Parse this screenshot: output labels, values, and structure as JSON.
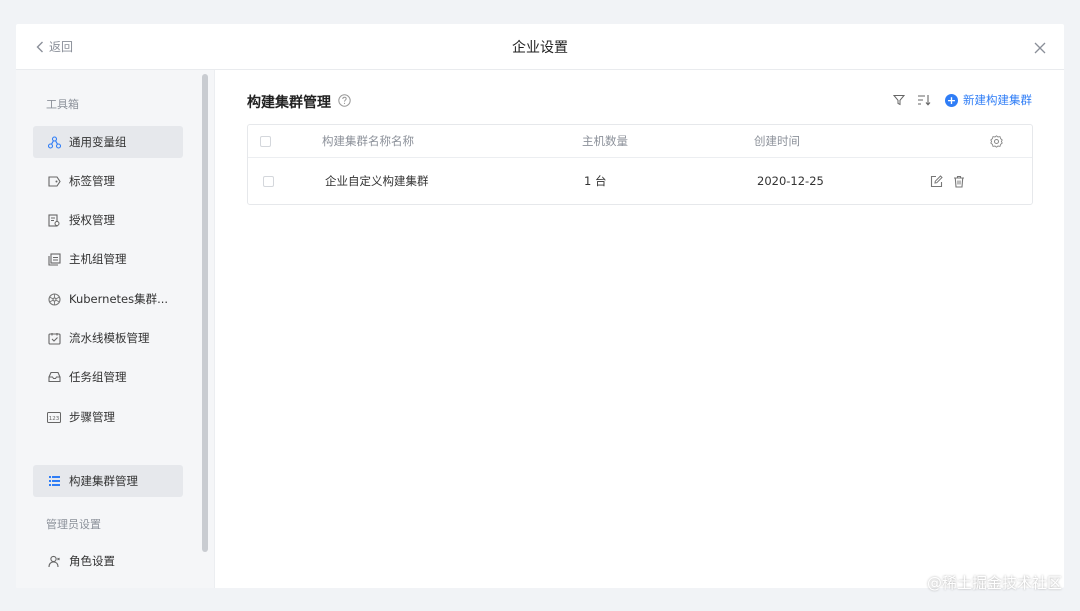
{
  "header": {
    "back_label": "返回",
    "title": "企业设置"
  },
  "sidebar": {
    "section_tools": "工具箱",
    "items": [
      {
        "label": "通用变量组",
        "icon": "variable-group-icon",
        "active": true
      },
      {
        "label": "标签管理",
        "icon": "tag-icon",
        "active": false
      },
      {
        "label": "授权管理",
        "icon": "authorization-icon",
        "active": false
      },
      {
        "label": "主机组管理",
        "icon": "host-group-icon",
        "active": false
      },
      {
        "label": "Kubernetes集群...",
        "icon": "kubernetes-icon",
        "active": false
      },
      {
        "label": "流水线模板管理",
        "icon": "pipeline-template-icon",
        "active": false
      },
      {
        "label": "任务组管理",
        "icon": "task-group-icon",
        "active": false
      },
      {
        "label": "步骤管理",
        "icon": "step-icon",
        "active": false
      },
      {
        "label": "构建集群管理",
        "icon": "build-cluster-icon",
        "active": true
      }
    ],
    "section_admin": "管理员设置",
    "admin_items": [
      {
        "label": "角色设置",
        "icon": "role-icon"
      }
    ]
  },
  "main": {
    "title": "构建集群管理",
    "new_button": "新建构建集群",
    "columns": [
      "构建集群名称名称",
      "主机数量",
      "创建时间"
    ],
    "rows": [
      {
        "name": "企业自定义构建集群",
        "hosts": "1 台",
        "created": "2020-12-25"
      }
    ]
  },
  "watermark": "@稀土掘金技术社区",
  "colors": {
    "accent": "#2f7df6",
    "active_bg": "#e6e8ec"
  }
}
